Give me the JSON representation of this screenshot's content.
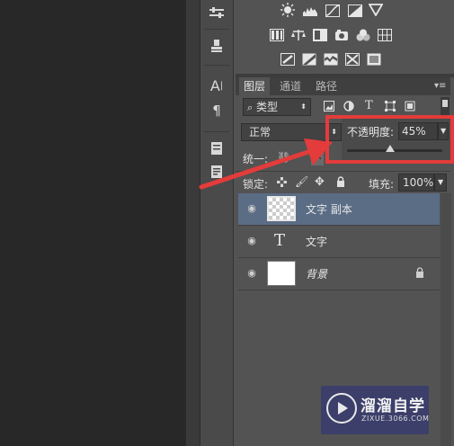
{
  "layers_panel": {
    "tabs": [
      {
        "label": "图层"
      },
      {
        "label": "通道"
      },
      {
        "label": "路径"
      }
    ],
    "filter": {
      "kind_label": "类型"
    },
    "blend_mode": "正常",
    "opacity": {
      "label": "不透明度:",
      "value": "45%",
      "slider_fraction": 0.45
    },
    "unify_label": "统一:",
    "lock_label": "锁定:",
    "fill": {
      "label": "填充:",
      "value": "100%"
    },
    "layers": [
      {
        "name": "文字 副本",
        "type": "transparent",
        "selected": true
      },
      {
        "name": "文字",
        "type": "text",
        "selected": false
      },
      {
        "name": "背景",
        "type": "white",
        "selected": false,
        "locked": true
      }
    ]
  },
  "watermark": {
    "title": "溜溜自学",
    "url": "ZIXUE.3066.COM"
  },
  "colors": {
    "highlight": "#e43b3b",
    "selected_row": "#5b6d85",
    "panel": "#535353"
  }
}
